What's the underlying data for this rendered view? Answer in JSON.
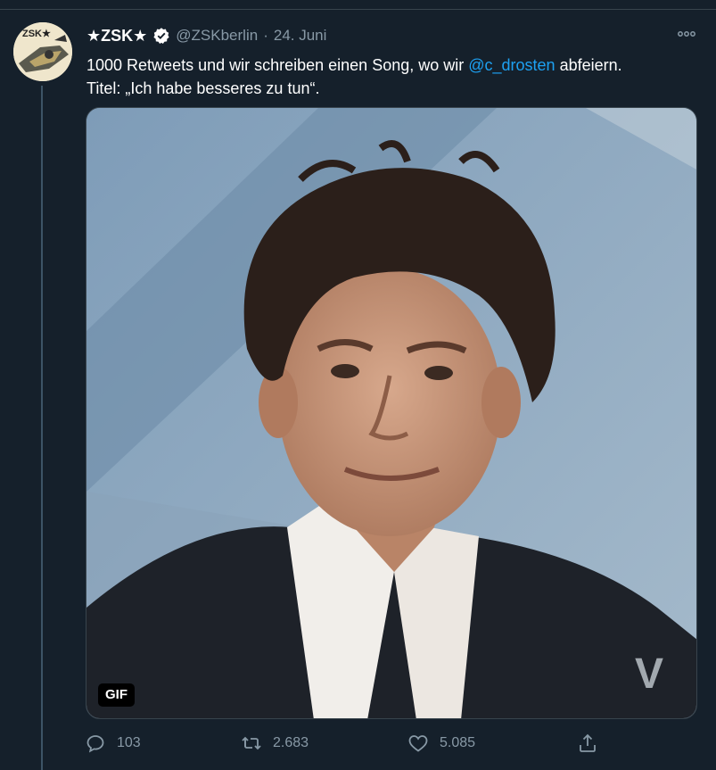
{
  "tweet": {
    "display_name": "★ZSK★",
    "handle": "@ZSKberlin",
    "separator": "·",
    "date": "24. Juni",
    "text_part1": "1000 Retweets und wir schreiben einen Song, wo wir ",
    "mention": "@c_drosten",
    "text_part2": " abfeiern.",
    "text_line2": "Titel: „Ich habe besseres zu tun“.",
    "media_badge": "GIF",
    "media_watermark": "V",
    "avatar_logo": "ZSK★"
  },
  "actions": {
    "reply_count": "103",
    "retweet_count": "2.683",
    "like_count": "5.085"
  },
  "colors": {
    "background": "#15202b",
    "accent": "#1da1f2",
    "muted": "#8899a6"
  },
  "icons": [
    "verified-icon",
    "more-icon",
    "reply-icon",
    "retweet-icon",
    "like-icon",
    "share-icon"
  ]
}
